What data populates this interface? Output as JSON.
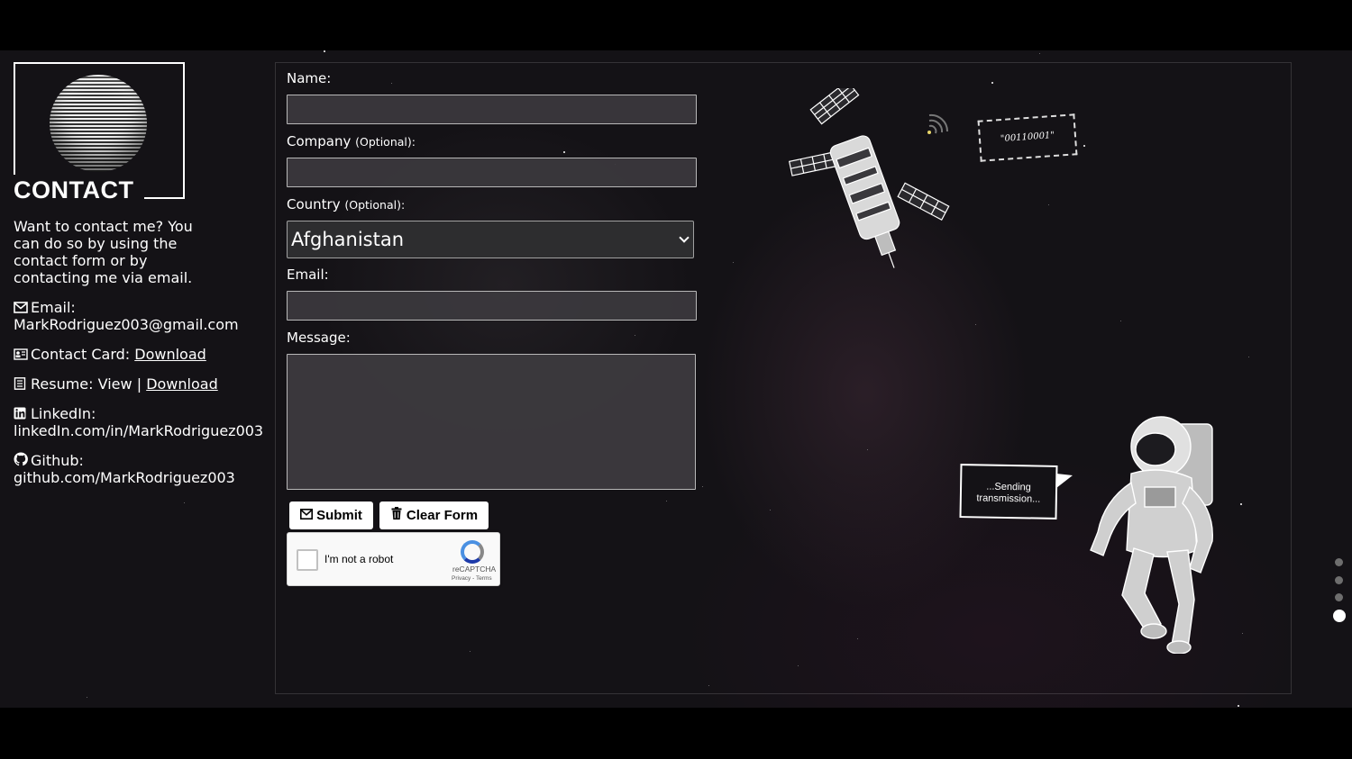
{
  "header": {
    "title": "CONTACT",
    "intro": "Want to contact me? You can do so by using the contact form or by contacting me via email."
  },
  "contact_info": {
    "email": {
      "icon": "envelope-icon",
      "label": "Email:",
      "value": "MarkRodriguez003@gmail.com"
    },
    "card": {
      "icon": "contact-card-icon",
      "label": "Contact Card:",
      "link": "Download"
    },
    "resume": {
      "icon": "document-icon",
      "label": "Resume:",
      "view": "View",
      "sep": "|",
      "link": "Download"
    },
    "linkedin": {
      "icon": "linkedin-icon",
      "label": "LinkedIn:",
      "value": "linkedIn.com/in/MarkRodriguez003"
    },
    "github": {
      "icon": "github-icon",
      "label": "Github:",
      "value": "github.com/MarkRodriguez003"
    }
  },
  "form": {
    "name_label": "Name:",
    "company_label": "Company",
    "company_opt": "(Optional):",
    "country_label": "Country",
    "country_opt": "(Optional):",
    "country_value": "Afghanistan",
    "email_label": "Email:",
    "message_label": "Message:",
    "name_value": "",
    "company_value": "",
    "email_value": "",
    "message_value": "",
    "submit_label": "Submit",
    "clear_label": "Clear Form"
  },
  "captcha": {
    "label": "I'm not a robot",
    "brand": "reCAPTCHA",
    "links": "Privacy - Terms"
  },
  "illustrations": {
    "binary_tag": "\"00110001\"",
    "sending_bubble": "...Sending transmission..."
  },
  "pagination": {
    "count": 4,
    "active_index": 3
  },
  "colors": {
    "background": "#141216",
    "text": "#ffffff",
    "button_bg": "#ffffff"
  }
}
